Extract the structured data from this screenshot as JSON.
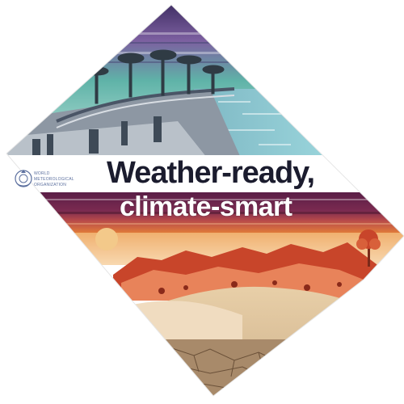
{
  "headline": {
    "line1": "Weather-ready,",
    "line2": "climate-smart"
  },
  "logo": {
    "lines": [
      "WORLD",
      "METEOROLOGICAL",
      "ORGANIZATION"
    ],
    "emblem_icon": "wmo-emblem-icon"
  },
  "colors": {
    "sky_teal": "#5fb3a8",
    "sea_blue": "#8fd3e0",
    "band_purple": "#5a1e46",
    "band_orange": "#e07a3a",
    "sun_yellow": "#f3c98a",
    "sand": "#e8cfa8",
    "rock_red": "#c8452a"
  }
}
